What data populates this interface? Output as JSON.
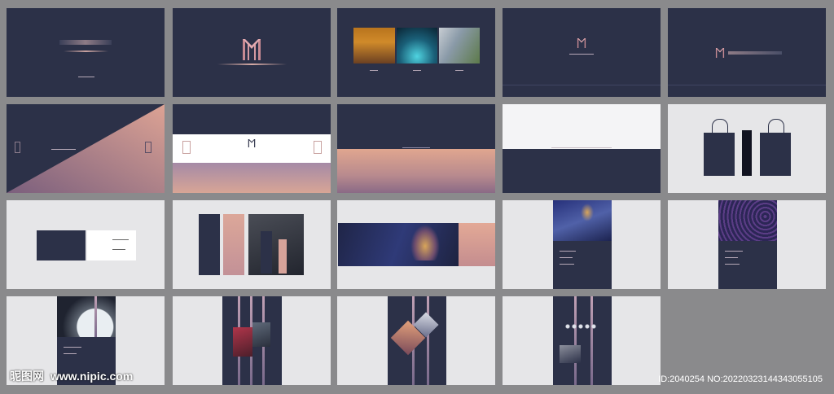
{
  "watermark": {
    "site_logo": "昵图网",
    "site_url": "www.nipic.com",
    "image_id": "ID:2040254 NO:20220323144343055105"
  },
  "icons": {
    "logo": "m-monogram-icon"
  },
  "colors": {
    "navy": "#2c3148",
    "rose": "#c88f86",
    "light_gray": "#e6e6e8",
    "background": "#8a8a8c"
  },
  "grid": {
    "rows": 4,
    "columns": 5,
    "tile_count": 19
  }
}
